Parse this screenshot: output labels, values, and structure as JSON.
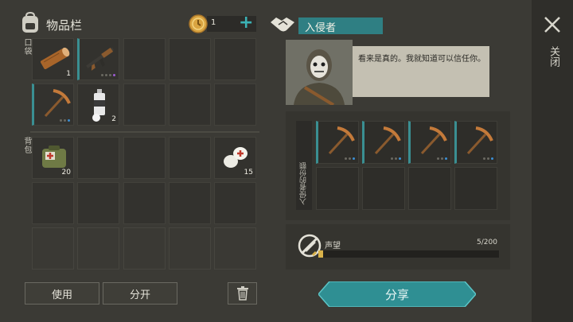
{
  "inventory": {
    "title": "物品栏",
    "coins": "1",
    "plus": "+",
    "pocket_label": "口袋",
    "backpack_label": "背包",
    "items": {
      "log_count": "1",
      "paint_count": "2",
      "bag_count": "20",
      "bandage_count": "15"
    },
    "use_button": "使用",
    "split_button": "分开"
  },
  "trader": {
    "name": "入侵者",
    "dialog": "看来是真的。我就知道可以信任你。",
    "share_section_label": "入侵者的份额",
    "reputation_label": "声望",
    "reputation_value": "5/200",
    "reputation_fraction": 0.025,
    "share_button": "分享"
  },
  "close": {
    "label": "关闭"
  },
  "colors": {
    "accent_teal": "#3bb2b5",
    "name_bar": "#2f7f83",
    "rep_fill": "#d9b24a"
  }
}
